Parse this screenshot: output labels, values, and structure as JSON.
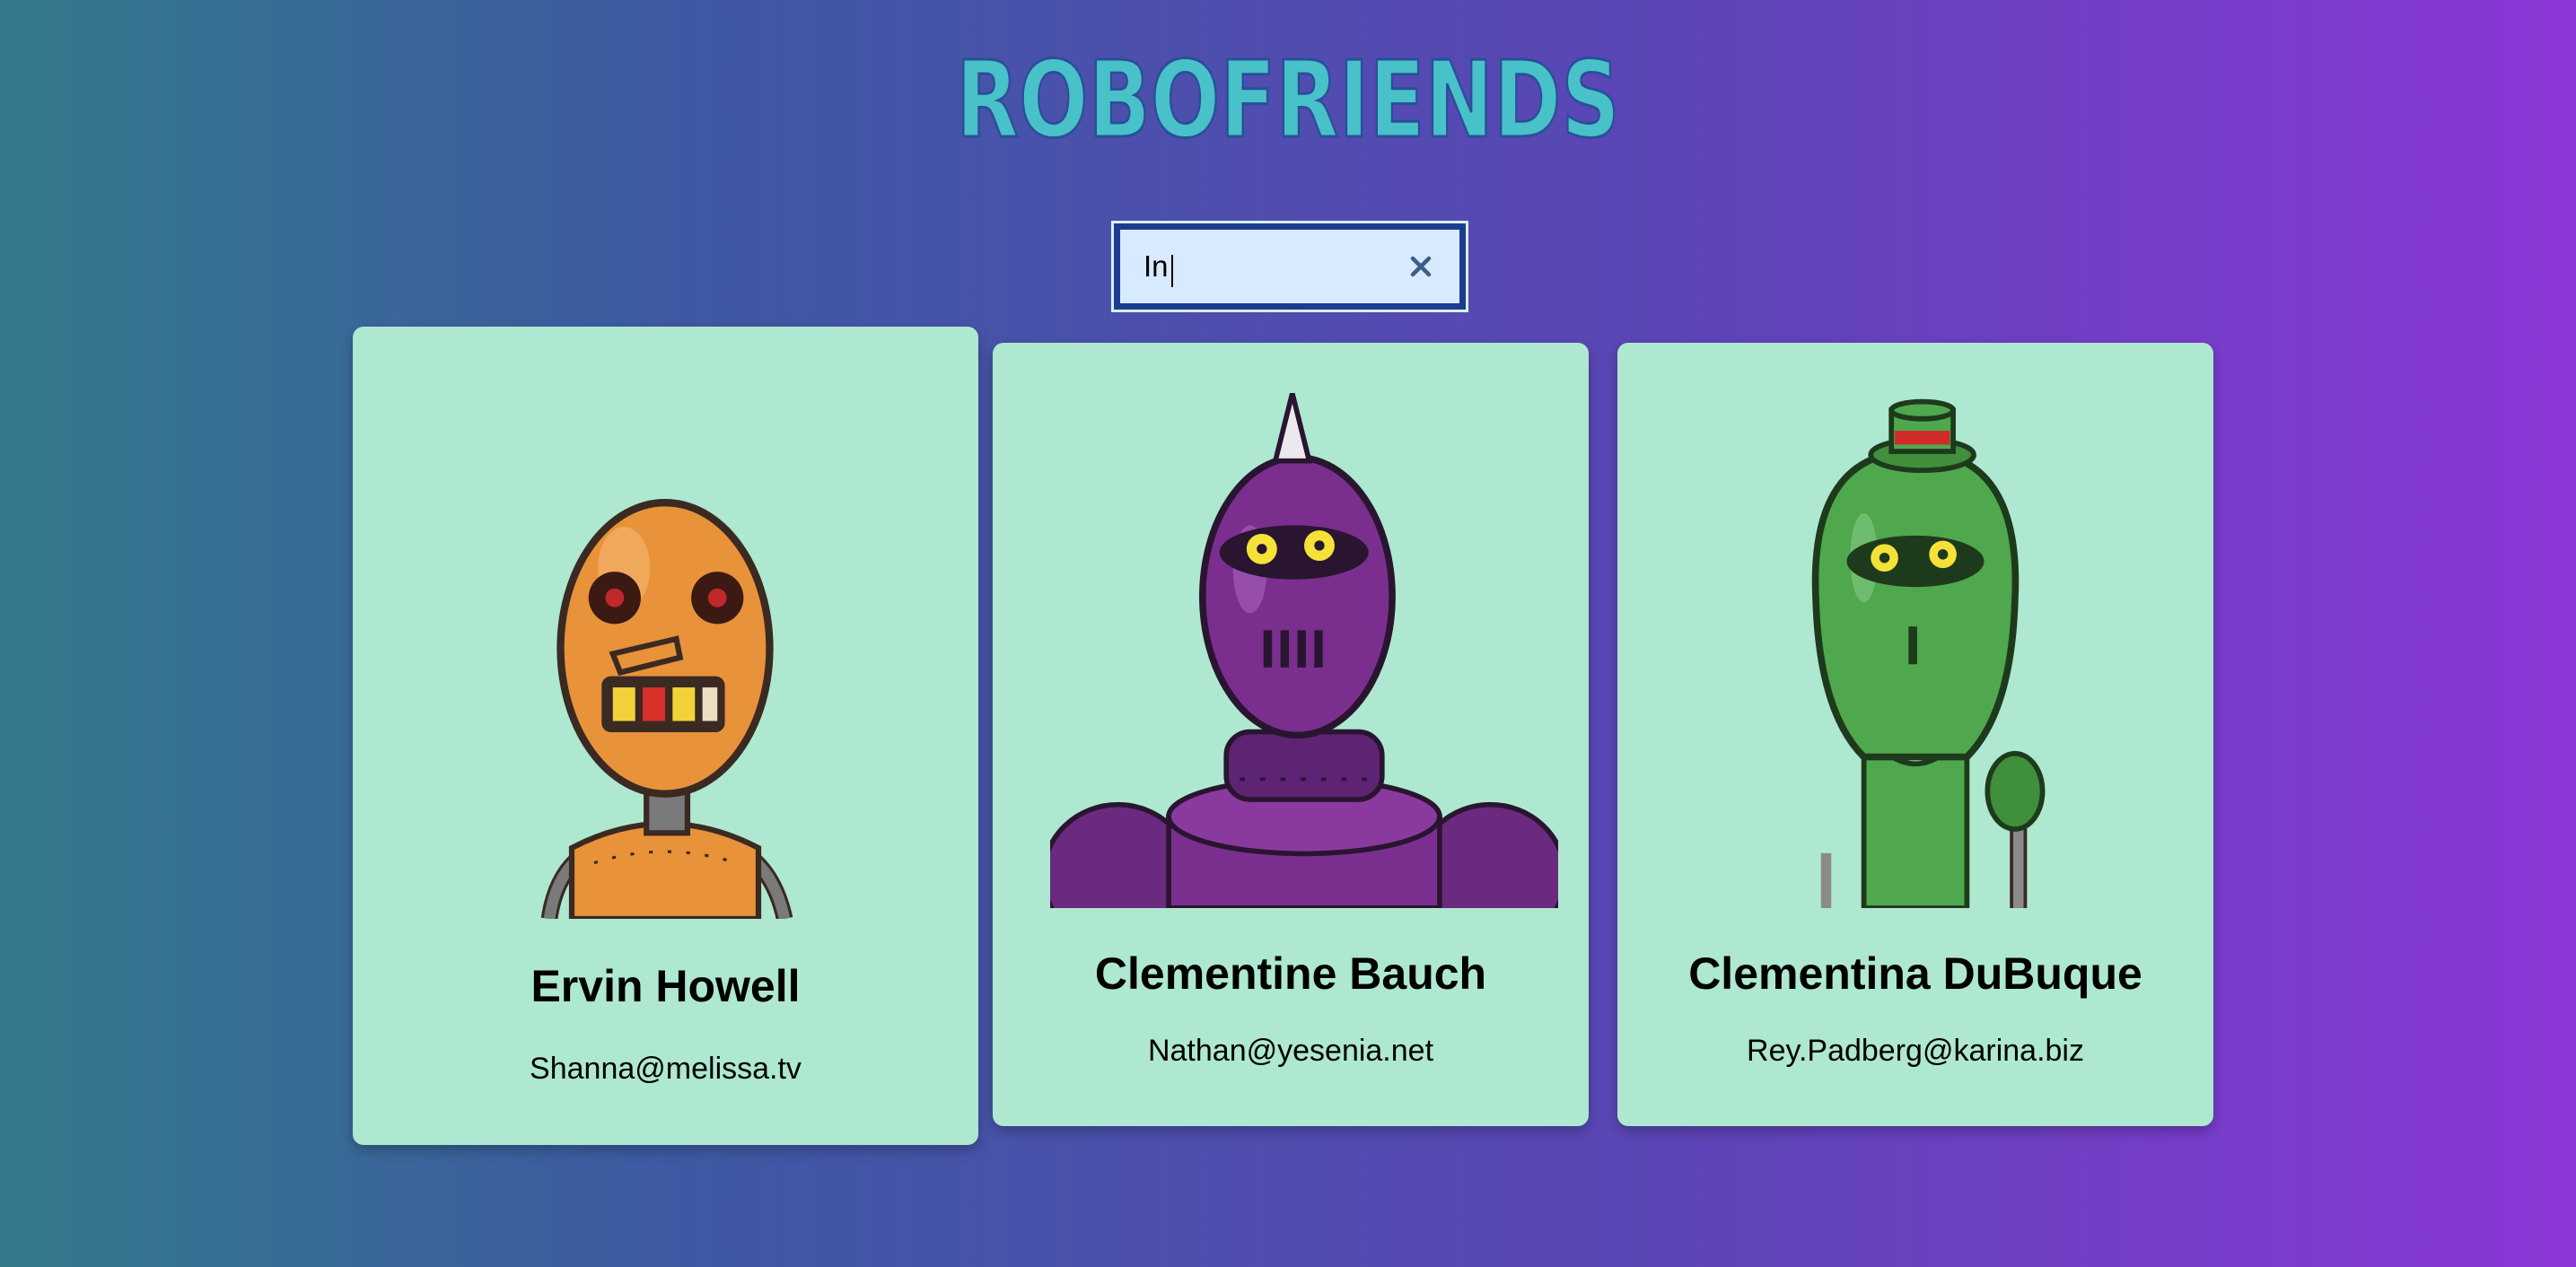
{
  "app": {
    "title": "ROBOFRIENDS"
  },
  "search": {
    "value": "In",
    "placeholder": "search robots"
  },
  "robots": [
    {
      "name": "Ervin Howell",
      "email": "Shanna@melissa.tv",
      "color": "#e8923a"
    },
    {
      "name": "Clementine Bauch",
      "email": "Nathan@yesenia.net",
      "color": "#7a2f8f"
    },
    {
      "name": "Clementina DuBuque",
      "email": "Rey.Padberg@karina.biz",
      "color": "#4fa84d"
    }
  ],
  "colors": {
    "title": "#49c1c9",
    "card_background": "#aee8d0",
    "search_background": "#d8eaff"
  },
  "icons": {
    "clear": "close-icon"
  }
}
